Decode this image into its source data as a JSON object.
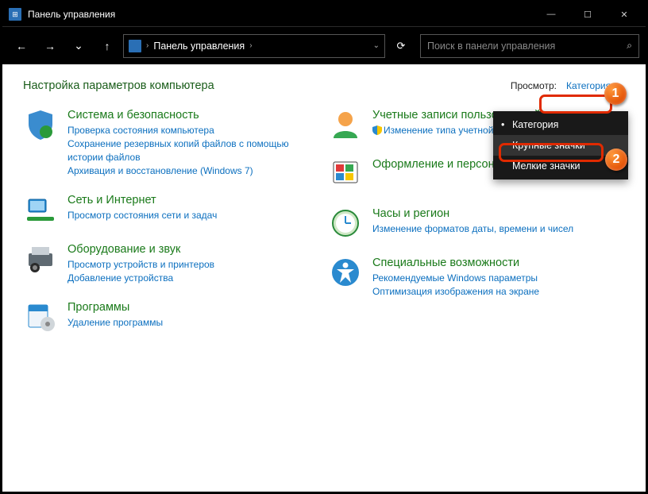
{
  "window": {
    "title": "Панель управления"
  },
  "titlebar": {
    "minimize": "—",
    "maximize": "☐",
    "close": "✕"
  },
  "nav": {
    "back": "←",
    "fwd": "→",
    "down": "⌄",
    "up": "↑",
    "crumb_root": "Панель управления",
    "refresh": "⟳"
  },
  "search": {
    "placeholder": "Поиск в панели управления",
    "icon": "⌕"
  },
  "page": {
    "heading": "Настройка параметров компьютера",
    "viewby_label": "Просмотр:",
    "viewby_value": "Категория"
  },
  "dropdown": {
    "items": [
      {
        "label": "Категория",
        "selected": true
      },
      {
        "label": "Крупные значки",
        "highlight": true
      },
      {
        "label": "Мелкие значки"
      }
    ]
  },
  "left_col": [
    {
      "title": "Система и безопасность",
      "links": [
        "Проверка состояния компьютера",
        "Сохранение резервных копий файлов с помощью истории файлов",
        "Архивация и восстановление (Windows 7)"
      ]
    },
    {
      "title": "Сеть и Интернет",
      "links": [
        "Просмотр состояния сети и задач"
      ]
    },
    {
      "title": "Оборудование и звук",
      "links": [
        "Просмотр устройств и принтеров",
        "Добавление устройства"
      ]
    },
    {
      "title": "Программы",
      "links": [
        "Удаление программы"
      ]
    }
  ],
  "right_col": [
    {
      "title": "Учетные записи пользователей",
      "links": [
        "Изменение типа учетной записи"
      ],
      "shield": true
    },
    {
      "title": "Оформление и персонализация",
      "links": []
    },
    {
      "title": "Часы и регион",
      "links": [
        "Изменение форматов даты, времени и чисел"
      ]
    },
    {
      "title": "Специальные возможности",
      "links": [
        "Рекомендуемые Windows параметры",
        "Оптимизация изображения на экране"
      ]
    }
  ],
  "callouts": {
    "one": "1",
    "two": "2"
  }
}
